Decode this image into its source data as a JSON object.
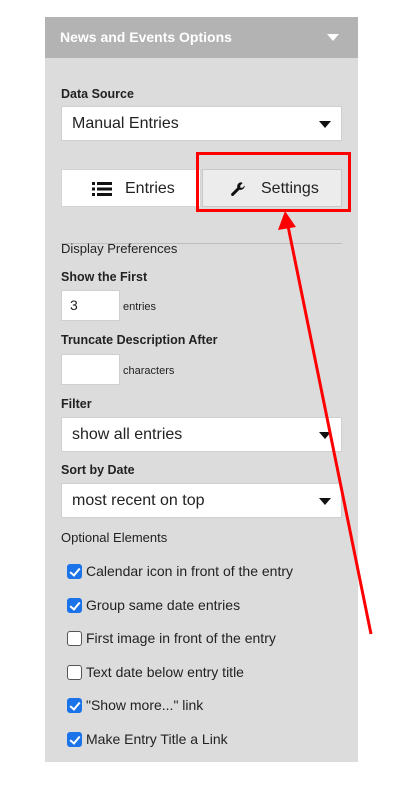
{
  "panel": {
    "title": "News and Events Options"
  },
  "data_source": {
    "label": "Data Source",
    "selected": "Manual Entries"
  },
  "tabs": [
    {
      "label": "Entries",
      "icon": "list-icon",
      "active": false
    },
    {
      "label": "Settings",
      "icon": "wrench-icon",
      "active": true
    }
  ],
  "display": {
    "heading": "Display Preferences",
    "show_first_label": "Show the First",
    "show_first_value": "3",
    "show_first_unit": "entries",
    "truncate_label": "Truncate Description After",
    "truncate_value": "",
    "truncate_unit": "characters",
    "filter_label": "Filter",
    "filter_selected": "show all entries",
    "sort_label": "Sort by Date",
    "sort_selected": "most recent on top"
  },
  "optional": {
    "heading": "Optional Elements",
    "items": [
      {
        "label": "Calendar icon in front of the entry",
        "checked": true
      },
      {
        "label": "Group same date entries",
        "checked": true
      },
      {
        "label": "First image in front of the entry",
        "checked": false
      },
      {
        "label": "Text date below entry title",
        "checked": false
      },
      {
        "label": "\"Show more...\" link",
        "checked": true
      },
      {
        "label": "Make Entry Title a Link",
        "checked": true
      }
    ]
  },
  "colors": {
    "panel_bg": "#dcdcdc",
    "header_bg": "#b3b3b3",
    "checkbox_on": "#1a73e8",
    "annotation": "#ff0000"
  }
}
